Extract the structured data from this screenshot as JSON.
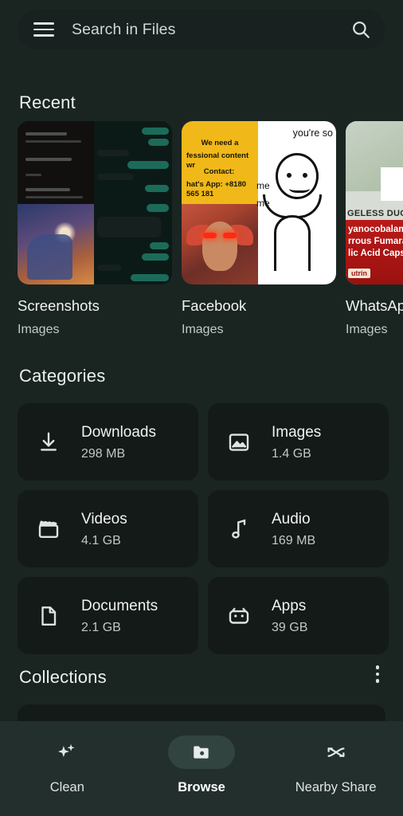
{
  "search": {
    "placeholder": "Search in Files",
    "menu_icon": "hamburger-menu-icon",
    "search_icon": "search-icon"
  },
  "sections": {
    "recent_title": "Recent",
    "categories_title": "Categories",
    "collections_title": "Collections",
    "overflow_icon": "more-vertical-icon"
  },
  "recent": {
    "items": [
      {
        "name": "Screenshots",
        "type": "Images"
      },
      {
        "name": "Facebook",
        "type": "Images"
      },
      {
        "name": "WhatsApp",
        "type": "Images"
      }
    ]
  },
  "thumbnails": {
    "facebook_ad_line1": "We need a",
    "facebook_ad_line2": "fessional content wr",
    "facebook_ad_line3": "Contact:",
    "facebook_ad_line4": "hat's App: +8180 565 181",
    "meme_caption": "you're so",
    "meme_label1": "me",
    "meme_label2": "me",
    "whatsapp_label": "GELESS DUO",
    "whatsapp_text1": "yanocobalamin,",
    "whatsapp_text2": "rrous Fumarate an",
    "whatsapp_text3": "lic Acid Capsules",
    "whatsapp_badge": "utrin"
  },
  "categories": [
    {
      "name": "Downloads",
      "size": "298 MB",
      "icon": "download-icon"
    },
    {
      "name": "Images",
      "size": "1.4 GB",
      "icon": "image-icon"
    },
    {
      "name": "Videos",
      "size": "4.1 GB",
      "icon": "video-clapperboard-icon"
    },
    {
      "name": "Audio",
      "size": "169 MB",
      "icon": "music-note-icon"
    },
    {
      "name": "Documents",
      "size": "2.1 GB",
      "icon": "document-page-icon"
    },
    {
      "name": "Apps",
      "size": "39 GB",
      "icon": "android-robot-icon"
    }
  ],
  "bottom_nav": {
    "items": [
      {
        "label": "Clean",
        "icon": "sparkles-icon",
        "active": false
      },
      {
        "label": "Browse",
        "icon": "folder-search-icon",
        "active": true
      },
      {
        "label": "Nearby Share",
        "icon": "nearby-share-icon",
        "active": false
      }
    ]
  },
  "colors": {
    "page_background": "#1a2522",
    "card_background": "#131a18",
    "search_background": "#18211f",
    "nav_background": "#232f2c",
    "active_pill": "#32443f",
    "primary_text": "#f0f3f1",
    "secondary_text": "#c2c8c4"
  }
}
